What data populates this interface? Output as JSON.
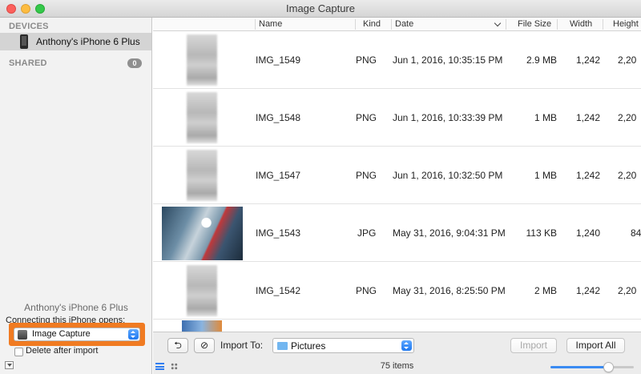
{
  "window": {
    "title": "Image Capture"
  },
  "sidebar": {
    "devices_label": "DEVICES",
    "device_name": "Anthony's iPhone 6 Plus",
    "shared_label": "SHARED",
    "shared_count": "0",
    "device_title": "Anthony's iPhone 6 Plus",
    "connect_label": "Connecting this iPhone opens:",
    "connect_app": "Image Capture",
    "delete_after_import": "Delete after import",
    "delete_checked": false
  },
  "table": {
    "columns": [
      "Name",
      "Kind",
      "Date",
      "File Size",
      "Width",
      "Height"
    ],
    "sort_column": "Date",
    "rows": [
      {
        "name": "IMG_1549",
        "kind": "PNG",
        "date": "Jun 1, 2016, 10:35:15 PM",
        "size": "2.9 MB",
        "width": "1,242",
        "height": "2,20"
      },
      {
        "name": "IMG_1548",
        "kind": "PNG",
        "date": "Jun 1, 2016, 10:33:39 PM",
        "size": "1 MB",
        "width": "1,242",
        "height": "2,20"
      },
      {
        "name": "IMG_1547",
        "kind": "PNG",
        "date": "Jun 1, 2016, 10:32:50 PM",
        "size": "1 MB",
        "width": "1,242",
        "height": "2,20"
      },
      {
        "name": "IMG_1543",
        "kind": "JPG",
        "date": "May 31, 2016, 9:04:31 PM",
        "size": "113 KB",
        "width": "1,240",
        "height": "84"
      },
      {
        "name": "IMG_1542",
        "kind": "PNG",
        "date": "May 31, 2016, 8:25:50 PM",
        "size": "2 MB",
        "width": "1,242",
        "height": "2,20"
      }
    ]
  },
  "bottombar": {
    "rotate_icon": "rotate-left-icon",
    "delete_icon": "no-entry-icon",
    "import_to_label": "Import To:",
    "import_to_value": "Pictures",
    "import_label": "Import",
    "import_all_label": "Import All",
    "status": "75 items",
    "thumbnail_size_fraction": 0.72
  },
  "colors": {
    "accent": "#2f7df0",
    "highlight_outline": "#f07b22"
  }
}
